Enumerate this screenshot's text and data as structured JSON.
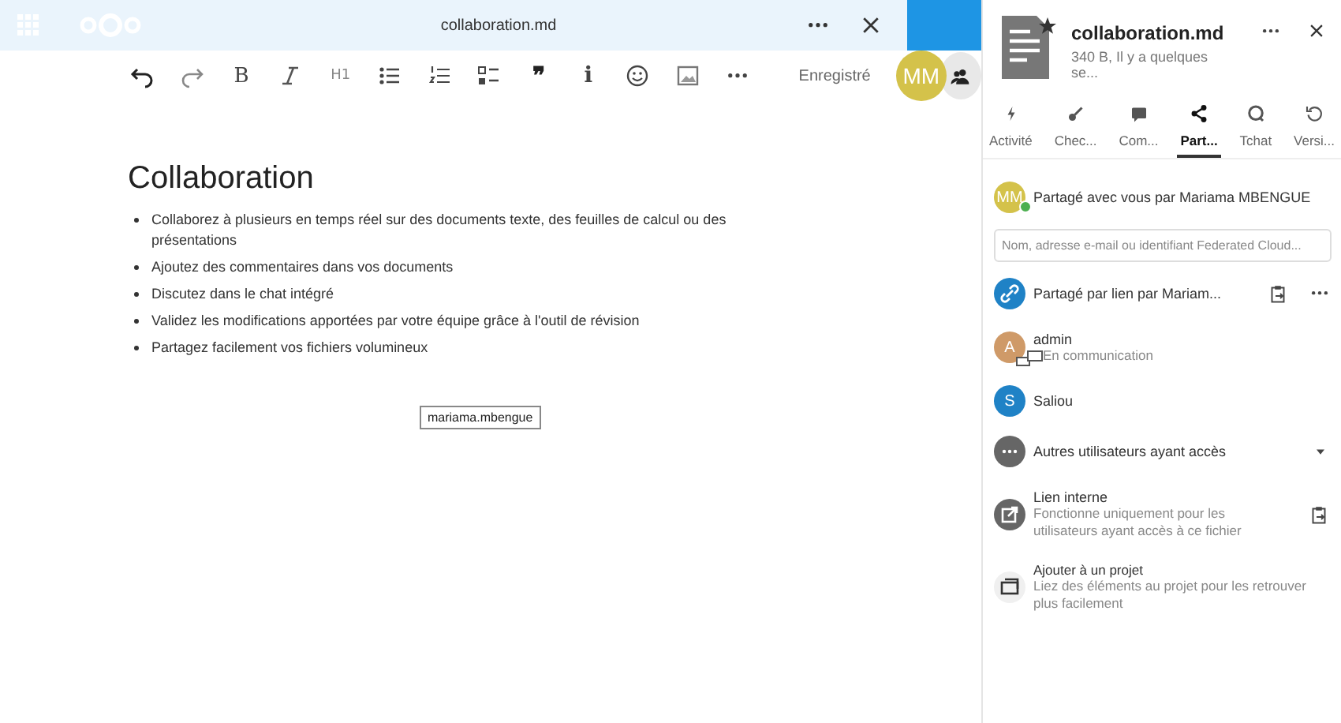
{
  "editor": {
    "title": "collaboration.md",
    "status": "Enregistré",
    "avatar": {
      "initials": "MM",
      "color": "#d4c24a"
    },
    "toolbar": [
      {
        "kind": "undo"
      },
      {
        "kind": "redo"
      },
      {
        "kind": "glyph",
        "label": "B"
      },
      {
        "kind": "italic"
      },
      {
        "kind": "glyph",
        "label": "H1"
      },
      {
        "kind": "bullets"
      },
      {
        "kind": "numbers"
      },
      {
        "kind": "checklist"
      },
      {
        "kind": "glyph",
        "label": "❞"
      },
      {
        "kind": "glyph",
        "label": "i"
      },
      {
        "kind": "emoji"
      },
      {
        "kind": "image"
      },
      {
        "kind": "more"
      }
    ],
    "heading": "Collaboration",
    "bullets": [
      "Collaborez à plusieurs en temps réel sur des documents texte, des feuilles de calcul ou des présentations",
      "Ajoutez des commentaires dans vos documents",
      "Discutez dans le chat intégré",
      "Validez les modifications apportées par votre équipe grâce à l'outil de révision",
      "Partagez facilement vos fichiers volumineux"
    ],
    "cursor_label": "mariama.mbengue"
  },
  "sidebar": {
    "title": "collaboration.md",
    "subtitle": "340 B, Il y a quelques se...",
    "tabs": [
      {
        "label": "Activité",
        "kind": "bolt",
        "selected": false
      },
      {
        "label": "Chec...",
        "kind": "key",
        "selected": false
      },
      {
        "label": "Com...",
        "kind": "comment",
        "selected": false
      },
      {
        "label": "Part...",
        "kind": "share",
        "selected": true
      },
      {
        "label": "Tchat",
        "kind": "chat",
        "selected": false
      },
      {
        "label": "Versi...",
        "kind": "history",
        "selected": false
      }
    ],
    "owner": {
      "initials": "MM",
      "color": "#d4c24a",
      "text": "Partagé avec vous par Mariama MBENGUE"
    },
    "search": {
      "placeholder": "Nom, adresse e-mail ou identifiant Federated Cloud..."
    },
    "entries": [
      {
        "kind": "link",
        "title": "Partagé par lien par Mariam..."
      },
      {
        "kind": "user",
        "initials": "A",
        "color": "#cf9a68",
        "title": "admin",
        "subtitle": "En communication"
      },
      {
        "kind": "user",
        "initials": "S",
        "color": "#1f82c6",
        "title": "Saliou"
      },
      {
        "kind": "others",
        "title": "Autres utilisateurs ayant accès"
      },
      {
        "kind": "internal",
        "title": "Lien interne",
        "subtitle": "Fonctionne uniquement pour les utilisateurs ayant accès à ce fichier"
      },
      {
        "kind": "project",
        "title": "Ajouter à un projet",
        "subtitle": "Liez des éléments au projet pour les retrouver plus facilement"
      }
    ]
  }
}
